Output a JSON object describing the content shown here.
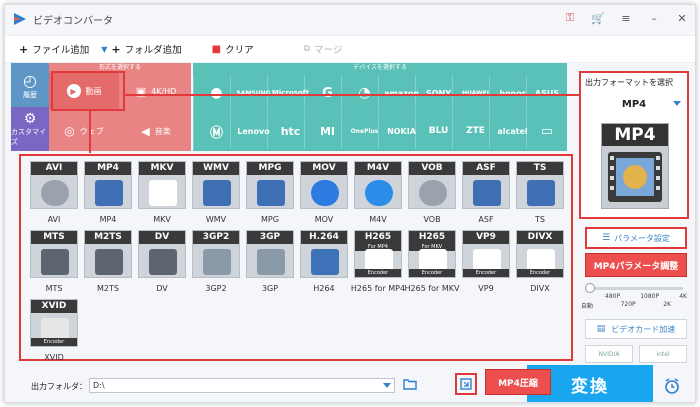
{
  "window": {
    "title": "ビデオコンバータ",
    "controls": [
      "key-icon",
      "cart-icon",
      "menu-icon",
      "minimize-icon",
      "close-icon"
    ]
  },
  "toolbar": {
    "add_file": "ファイル追加",
    "add_folder": "フォルダ追加",
    "clear": "クリア",
    "merge": "マージ"
  },
  "categories": {
    "side": [
      {
        "label": "履歴",
        "icon": "history-icon"
      },
      {
        "label": "カスタマイズ",
        "icon": "customize-icon"
      }
    ],
    "format_header": "形式を選択する",
    "formats": [
      {
        "label": "動画",
        "icon": "play-icon",
        "selected": true
      },
      {
        "label": "4K/HD",
        "icon": "hd-icon",
        "selected": false
      },
      {
        "label": "ウェブ",
        "icon": "chrome-icon",
        "selected": false
      },
      {
        "label": "音楽",
        "icon": "speaker-icon",
        "selected": false
      }
    ],
    "device_header": "デバイスを選択する",
    "devices_row1": [
      "apple-icon",
      "SAMSUNG",
      "Microsoft",
      "G",
      "lg-icon",
      "amazon",
      "SONY",
      "HUAWEI",
      "honor",
      "ASUS"
    ],
    "devices_row2": [
      "motorola-icon",
      "Lenovo",
      "htc",
      "MI",
      "OnePlus",
      "NOKIA",
      "BLU",
      "ZTE",
      "alcatel",
      "tv-icon"
    ]
  },
  "formats": [
    {
      "name": "AVI",
      "label": "AVI",
      "sub": "",
      "art": "disc"
    },
    {
      "name": "MP4",
      "label": "MP4",
      "sub": "",
      "art": "film"
    },
    {
      "name": "MKV",
      "label": "MKV",
      "sub": "",
      "art": "matroska"
    },
    {
      "name": "WMV",
      "label": "WMV",
      "sub": "",
      "art": "film"
    },
    {
      "name": "MPG",
      "label": "MPG",
      "sub": "",
      "art": "film"
    },
    {
      "name": "MOV",
      "label": "MOV",
      "sub": "",
      "art": "quicktime"
    },
    {
      "name": "M4V",
      "label": "M4V",
      "sub": "",
      "art": "itunes"
    },
    {
      "name": "VOB",
      "label": "VOB",
      "sub": "",
      "art": "disc"
    },
    {
      "name": "ASF",
      "label": "ASF",
      "sub": "",
      "art": "film"
    },
    {
      "name": "TS",
      "label": "TS",
      "sub": "",
      "art": "film"
    },
    {
      "name": "MTS",
      "label": "MTS",
      "sub": "",
      "art": "camcorder"
    },
    {
      "name": "M2TS",
      "label": "M2TS",
      "sub": "",
      "art": "camcorder"
    },
    {
      "name": "DV",
      "label": "DV",
      "sub": "",
      "art": "camcorder"
    },
    {
      "name": "3GP2",
      "label": "3GP2",
      "sub": "",
      "art": "phone"
    },
    {
      "name": "3GP",
      "label": "3GP",
      "sub": "",
      "art": "phone"
    },
    {
      "name": "H.264",
      "label": "H264",
      "sub": "",
      "art": "h264"
    },
    {
      "name": "H265",
      "label": "H265 for MP4",
      "sub": "For MP4",
      "art": "hevc"
    },
    {
      "name": "H265",
      "label": "H265 for MKV",
      "sub": "For MKV",
      "art": "hevc"
    },
    {
      "name": "VP9",
      "label": "VP9",
      "sub": "",
      "art": "vp9"
    },
    {
      "name": "DIVX",
      "label": "DIVX",
      "sub": "",
      "art": "divx"
    },
    {
      "name": "XVID",
      "label": "XVID",
      "sub": "",
      "art": "xvid"
    }
  ],
  "encoder_text": "Encoder",
  "output": {
    "header": "出力フォーマットを選択",
    "format": "MP4",
    "param_button": "パラメータ設定",
    "param_callout": "MP4パラメータ調整",
    "quality_ticks_top": [
      "480P",
      "1080P",
      "4K"
    ],
    "quality_ticks_bottom": [
      "自動",
      "720P",
      "2K"
    ],
    "gpu_button": "ビデオカード加速",
    "gpu_vendors": [
      "NVIDIA",
      "intel"
    ]
  },
  "bottom": {
    "output_folder_label": "出力フォルダ：",
    "output_folder_value": "D:\\",
    "compress_callout": "MP4圧縮",
    "convert_button": "変換"
  },
  "colors": {
    "accent_red": "#e23a3a",
    "format_panel": "#e98484",
    "device_panel": "#59c1b7",
    "side_panel": "#5e97c6",
    "convert_blue": "#1aa6ef"
  }
}
